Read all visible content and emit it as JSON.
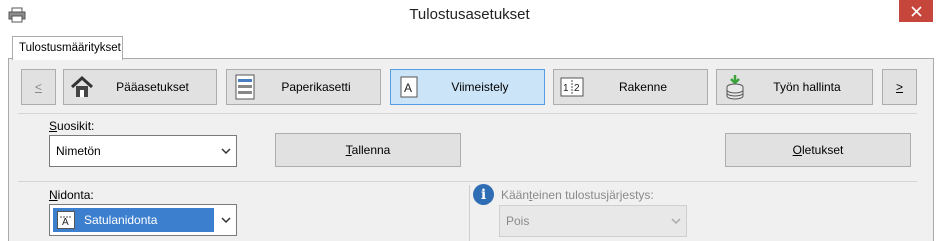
{
  "window": {
    "title": "Tulostusasetukset",
    "app_icon": "printer-icon",
    "close_icon": "close-icon"
  },
  "tabs": [
    {
      "label": "Tulostusmääritykset",
      "active": true
    }
  ],
  "nav": {
    "prev_label": "<",
    "next_label": ">",
    "buttons": [
      {
        "label": "Pääasetukset",
        "icon": "house-icon",
        "active": false
      },
      {
        "label": "Paperikasetti",
        "icon": "paper-tray-icon",
        "active": false
      },
      {
        "label": "Viimeistely",
        "icon": "finishing-icon",
        "active": true
      },
      {
        "label": "Rakenne",
        "icon": "layout-icon",
        "active": false
      },
      {
        "label": "Työn hallinta",
        "icon": "job-storage-icon",
        "active": false
      }
    ],
    "active_color": "#cce4f7"
  },
  "favorites": {
    "label_prefix": "",
    "label_accel": "S",
    "label_rest": "uosikit:",
    "value": "Nimetön",
    "save_accel": "T",
    "save_rest": "allenna",
    "defaults_accel": "O",
    "defaults_rest": "letukset"
  },
  "binding": {
    "label_accel": "N",
    "label_rest": "idonta:",
    "value": "Satulanidonta",
    "icon": "saddle-stitch-icon",
    "highlight_color": "#3c7fcf"
  },
  "reverse_order": {
    "label_before": "Kään",
    "label_accel": "t",
    "label_after": "einen tulostusjärjestys:",
    "value": "Pois",
    "enabled": false,
    "info_icon": "info-icon"
  }
}
